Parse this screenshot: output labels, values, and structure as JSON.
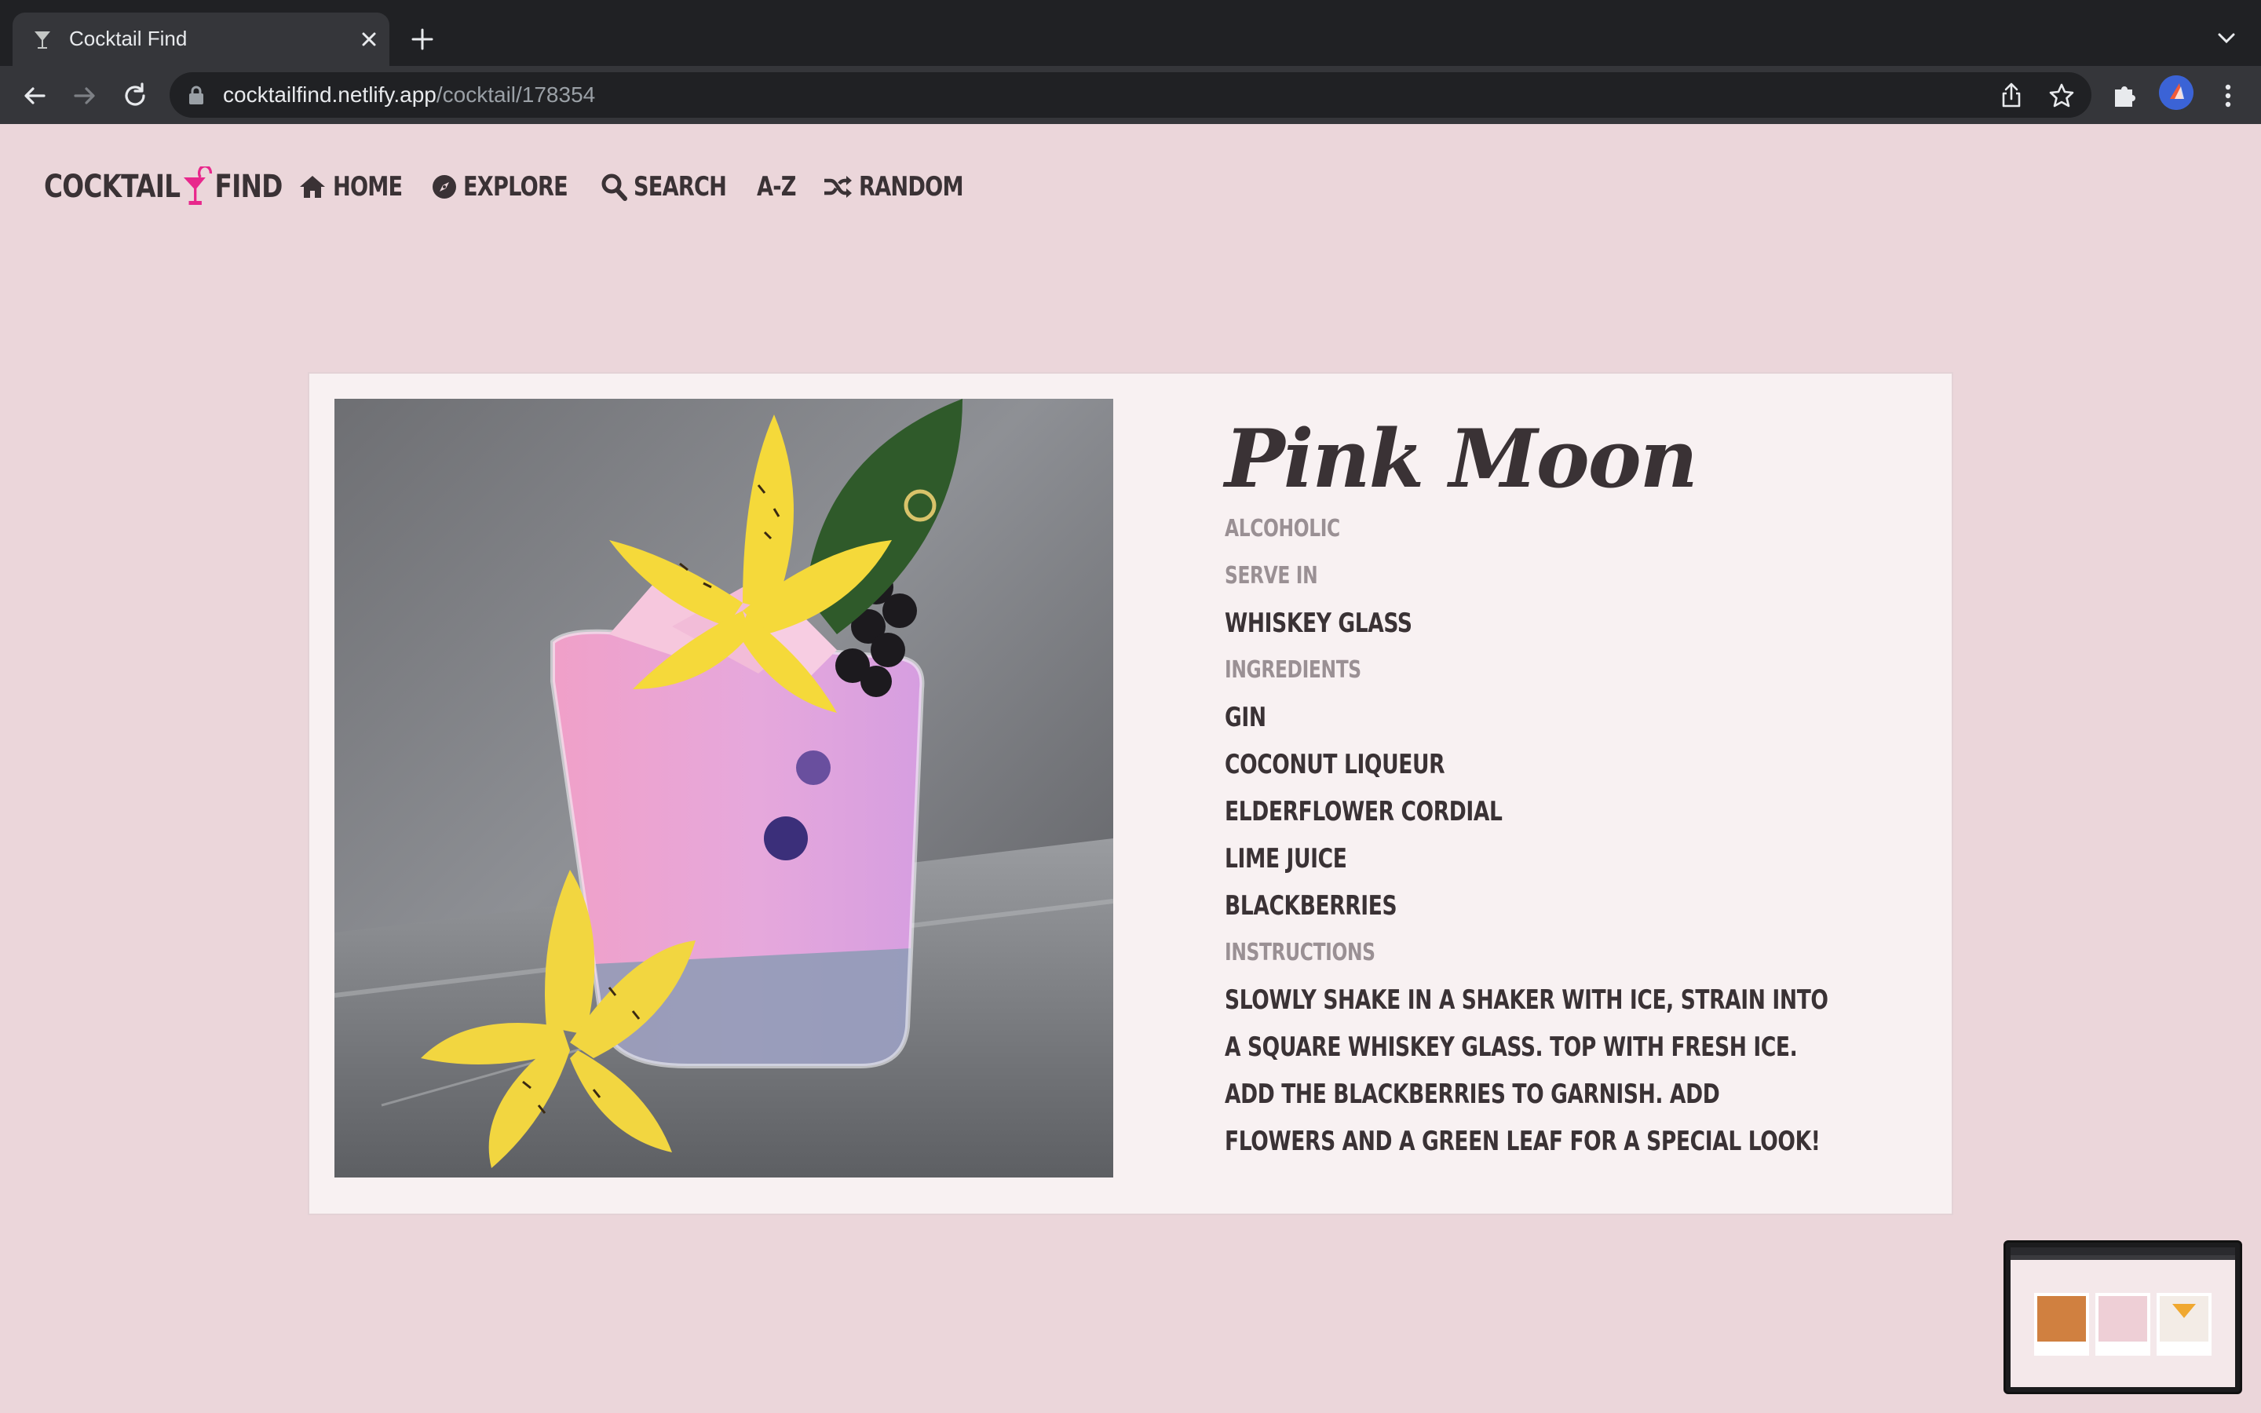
{
  "browser": {
    "tab_title": "Cocktail Find",
    "url_host": "cocktailfind.netlify.app",
    "url_path": "/cocktail/178354"
  },
  "site": {
    "logo_left": "COCKTAIL",
    "logo_right": "FIND",
    "accent_color": "#e8288c",
    "nav": [
      {
        "label": "HOME",
        "icon": "home-icon"
      },
      {
        "label": "EXPLORE",
        "icon": "compass-icon"
      },
      {
        "label": "SEARCH",
        "icon": "search-icon"
      },
      {
        "label": "A-Z",
        "icon": ""
      },
      {
        "label": "RANDOM",
        "icon": "shuffle-icon"
      }
    ]
  },
  "cocktail": {
    "name": "Pink Moon",
    "category": "ALCOHOLIC",
    "serve_in_label": "SERVE IN",
    "glass": "WHISKEY GLASS",
    "ingredients_label": "INGREDIENTS",
    "ingredients": [
      "GIN",
      "COCONUT LIQUEUR",
      "ELDERFLOWER CORDIAL",
      "LIME JUICE",
      "BLACKBERRIES"
    ],
    "instructions_label": "INSTRUCTIONS",
    "instructions": "SLOWLY SHAKE IN A SHAKER WITH ICE, STRAIN INTO A SQUARE WHISKEY GLASS. TOP WITH FRESH ICE. ADD THE BLACKBERRIES TO GARNISH. ADD FLOWERS AND A GREEN LEAF FOR A SPECIAL LOOK!",
    "image_alt": "pink-cocktail-photo"
  },
  "colors": {
    "page_bg": "#ebd6da",
    "card_bg": "#f8f1f2",
    "text_dark": "#3a3235",
    "text_muted": "#9a9094"
  }
}
